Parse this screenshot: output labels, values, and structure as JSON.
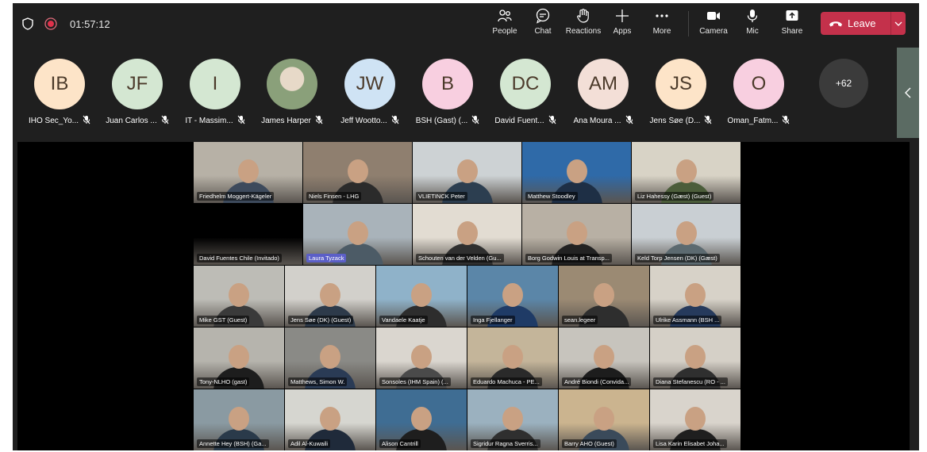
{
  "meeting": {
    "timer": "01:57:12"
  },
  "toolbar": {
    "people": "People",
    "chat": "Chat",
    "reactions": "Reactions",
    "apps": "Apps",
    "more": "More",
    "camera": "Camera",
    "mic": "Mic",
    "share": "Share",
    "leave": "Leave"
  },
  "colors": {
    "leave": "#c4314b",
    "accent": "#8b8cf6"
  },
  "strip": {
    "participants": [
      {
        "initials": "IB",
        "name": "IHO Sec_Yo...",
        "color": "#fde4c8"
      },
      {
        "initials": "JF",
        "name": "Juan Carlos ...",
        "color": "#d4e7d2"
      },
      {
        "initials": "I",
        "name": "IT - Massim...",
        "color": "#d4e7d2"
      },
      {
        "initials": "",
        "name": "James Harper",
        "color": "#8aa07a"
      },
      {
        "initials": "JW",
        "name": "Jeff Wootto...",
        "color": "#cfe3f4"
      },
      {
        "initials": "B",
        "name": "BSH (Gast) (...",
        "color": "#f8cfe0"
      },
      {
        "initials": "DC",
        "name": "David Fuent...",
        "color": "#d4e7d2"
      },
      {
        "initials": "AM",
        "name": "Ana Moura ...",
        "color": "#f3dfd7"
      },
      {
        "initials": "JS",
        "name": "Jens Søe (D...",
        "color": "#fde4c8"
      },
      {
        "initials": "O",
        "name": "Oman_Fatm...",
        "color": "#f8cfe0"
      }
    ],
    "overflow": "+62"
  },
  "grid": [
    {
      "name": "Friedhelm Moggert-Kägeler",
      "bg": "#b7b1a6",
      "shirt": "#3d4a5c"
    },
    {
      "name": "Niels Finsen - LHG",
      "bg": "#8f7f6f",
      "shirt": "#2b2b2b"
    },
    {
      "name": "VLIETINCK Peter",
      "bg": "#cdd2d4",
      "shirt": "#2c3e50"
    },
    {
      "name": "Matthew Stoodley",
      "bg": "#2f6aa8",
      "shirt": "#1e2f45"
    },
    {
      "name": "Liz Hahessy (Gæst) (Guest)",
      "bg": "#d8d3c6",
      "shirt": "#4b5d3a"
    },
    {
      "name": "David Fuentes Chile (Invitado)",
      "bg": "#000000",
      "shirt": "#000000"
    },
    {
      "name": "Laura Tyzack",
      "bg": "#a9b3ba",
      "shirt": "#4c5b66"
    },
    {
      "name": "Schouten van der Velden (Gu...",
      "bg": "#e2dcd2",
      "shirt": "#2f2f2f"
    },
    {
      "name": "Borg Godwin Louis at Transp...",
      "bg": "#b8b0a4",
      "shirt": "#222222"
    },
    {
      "name": "Keld Torp Jensen (DK) (Gæst)",
      "bg": "#c9cfd3",
      "shirt": "#5c6a70"
    },
    {
      "name": "Mike GST (Guest)",
      "bg": "#bdbcb6",
      "shirt": "#3a3a3a"
    },
    {
      "name": "Jens Søe (DK) (Guest)",
      "bg": "#d2d0cb",
      "shirt": "#2d3a4a"
    },
    {
      "name": "Vandaele Kaatje",
      "bg": "#8fb2c9",
      "shirt": "#2d2d2d"
    },
    {
      "name": "Inga Fjellanger",
      "bg": "#5b86a8",
      "shirt": "#1f3b66"
    },
    {
      "name": "sean.legeer",
      "bg": "#9b8a73",
      "shirt": "#2e2e2e"
    },
    {
      "name": "Ulrike Assmann (BSH ...",
      "bg": "#d7d2c8",
      "shirt": "#263a5c"
    },
    {
      "name": "Tony-NLHO (gast)",
      "bg": "#b6b4ad",
      "shirt": "#1d1d1d"
    },
    {
      "name": "Matthews, Simon W.",
      "bg": "#8a8a86",
      "shirt": "#2a3b55"
    },
    {
      "name": "Sonsoles (IHM Spain) (...",
      "bg": "#dad6cf",
      "shirt": "#4a4a4a"
    },
    {
      "name": "Eduardo Machuca - PE...",
      "bg": "#c4b59a",
      "shirt": "#2a2a2a"
    },
    {
      "name": "André Biondi (Convida...",
      "bg": "#c7c4bd",
      "shirt": "#1d1d1d"
    },
    {
      "name": "Diana Stefanescu (RO - ...",
      "bg": "#d5d0c7",
      "shirt": "#2f2f2f"
    },
    {
      "name": "Annette Hey (BSH) (Ga...",
      "bg": "#8a9aa2",
      "shirt": "#2a3a4a"
    },
    {
      "name": "Adil Al-Kuwaili",
      "bg": "#d6d6d0",
      "shirt": "#1f2a3a"
    },
    {
      "name": "Alison Cantrill",
      "bg": "#3f6d93",
      "shirt": "#1e1e1e"
    },
    {
      "name": "Sigridur Ragna Sverris...",
      "bg": "#9bb1bf",
      "shirt": "#2f2f2f"
    },
    {
      "name": "Barry AHO (Guest)",
      "bg": "#cbb48f",
      "shirt": "#3a4a5a"
    },
    {
      "name": "Lisa Karin Elisabet Joha...",
      "bg": "#d9d4cc",
      "shirt": "#1f1f1f"
    }
  ]
}
